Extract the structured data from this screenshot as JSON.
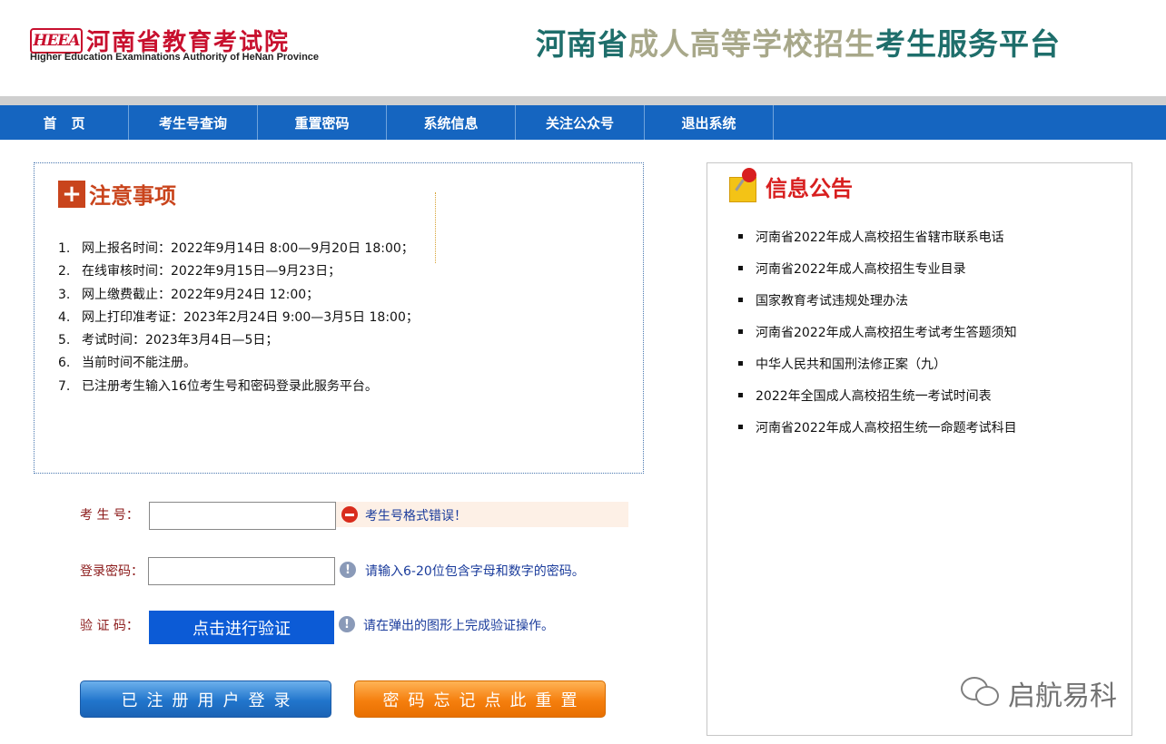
{
  "header": {
    "logo_badge": "HEEA",
    "logo_cn": "河南省教育考试院",
    "logo_en": "Higher Education Examinations Authority of HeNan Province",
    "title_part1": "河南省",
    "title_part2": "成人高等学校招生",
    "title_part3": "考生服务平台"
  },
  "nav": {
    "items": [
      {
        "label": "首页"
      },
      {
        "label": "考生号查询"
      },
      {
        "label": "重置密码"
      },
      {
        "label": "系统信息"
      },
      {
        "label": "关注公众号"
      },
      {
        "label": "退出系统"
      }
    ]
  },
  "notice": {
    "title": "注意事项",
    "items": [
      {
        "num": "1.",
        "text": "网上报名时间：2022年9月14日 8:00—9月20日 18:00；"
      },
      {
        "num": "2.",
        "text": "在线审核时间：2022年9月15日—9月23日；"
      },
      {
        "num": "3.",
        "text": "网上缴费截止：2022年9月24日 12:00；"
      },
      {
        "num": "4.",
        "text": "网上打印准考证：2023年2月24日 9:00—3月5日 18:00；"
      },
      {
        "num": "5.",
        "text": "考试时间：2023年3月4日—5日；"
      },
      {
        "num": "6.",
        "text": "当前时间不能注册。"
      },
      {
        "num": "7.",
        "text": "已注册考生输入16位考生号和密码登录此服务平台。"
      }
    ]
  },
  "info": {
    "title": "信息公告",
    "items": [
      {
        "text": "河南省2022年成人高校招生省辖市联系电话"
      },
      {
        "text": "河南省2022年成人高校招生专业目录"
      },
      {
        "text": "国家教育考试违规处理办法"
      },
      {
        "text": "河南省2022年成人高校招生考试考生答题须知"
      },
      {
        "text": "中华人民共和国刑法修正案（九）"
      },
      {
        "text": "2022年全国成人高校招生统一考试时间表"
      },
      {
        "text": "河南省2022年成人高校招生统一命题考试科目"
      }
    ]
  },
  "form": {
    "exam_no_label": "考 生 号：",
    "exam_no_value": "",
    "exam_no_error": "考生号格式错误！",
    "password_label": "登录密码：",
    "password_value": "",
    "password_hint": "请输入6-20位包含字母和数字的密码。",
    "captcha_label": "验 证 码：",
    "captcha_button": "点击进行验证",
    "captcha_hint": "请在弹出的图形上完成验证操作。",
    "login_button": "已注册用户登录",
    "reset_button": "密码忘记点此重置"
  },
  "watermark": {
    "text": "启航易科"
  },
  "colors": {
    "nav_bg": "#1565c0",
    "accent_red": "#c8102e",
    "login_blue": "#2175cc",
    "reset_orange": "#f57f0e"
  }
}
